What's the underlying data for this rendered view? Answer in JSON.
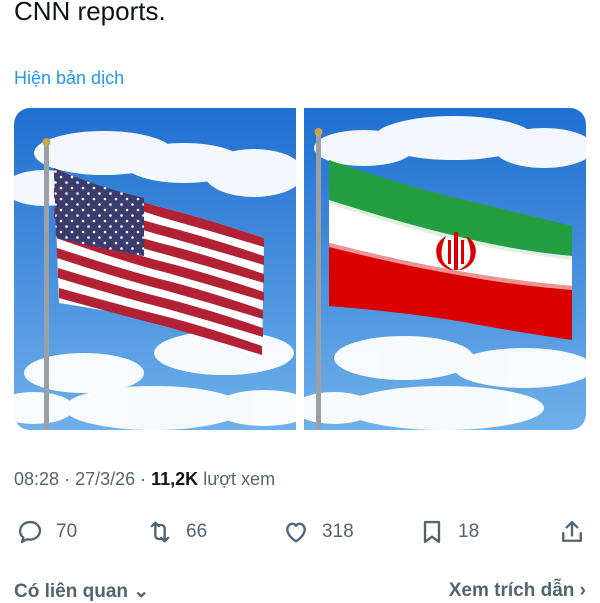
{
  "tweet": {
    "text": "CNN reports.",
    "translate_label": "Hiện bản dịch",
    "media": [
      {
        "name": "us-flag-image",
        "subject": "United States flag"
      },
      {
        "name": "iran-flag-image",
        "subject": "Iran flag"
      }
    ],
    "time": "08:28",
    "date": "27/3/26",
    "views_count": "11,2K",
    "views_label": "lượt xem"
  },
  "actions": {
    "reply_count": "70",
    "retweet_count": "66",
    "like_count": "318",
    "bookmark_count": "18"
  },
  "footer": {
    "related_label": "Có liên quan",
    "quotes_label": "Xem trích dẫn"
  },
  "colors": {
    "link": "#1d9bf0",
    "secondary_text": "#536471",
    "primary_text": "#0f1419"
  },
  "icons": [
    "reply-icon",
    "retweet-icon",
    "like-icon",
    "bookmark-icon",
    "share-icon",
    "chevron-down-icon",
    "chevron-right-icon"
  ]
}
